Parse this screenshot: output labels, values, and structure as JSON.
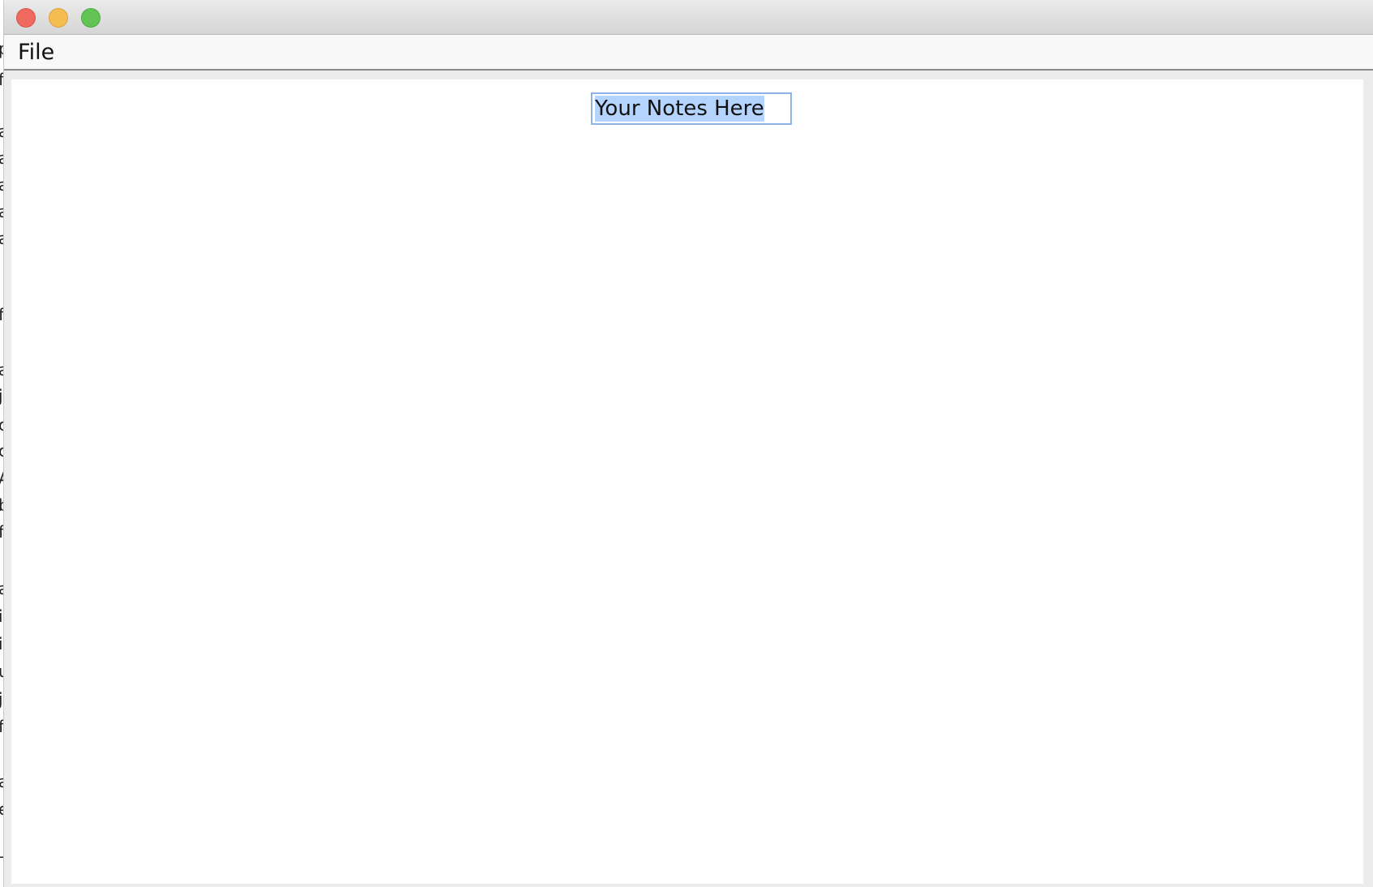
{
  "window": {
    "controls": {
      "close_icon": "close-icon",
      "minimize_icon": "minimize-icon",
      "zoom_icon": "zoom-icon"
    }
  },
  "menubar": {
    "items": [
      {
        "label": "File"
      }
    ]
  },
  "notes_field": {
    "value": "Your Notes Here",
    "selected": true
  },
  "background_window_fragments": [
    "p",
    "f",
    "a",
    "a",
    "a",
    "a",
    "a",
    "f",
    "a",
    "j",
    "c",
    "c",
    "A",
    "b",
    "f",
    "a",
    "i",
    "i",
    "u",
    "j",
    "f",
    "a",
    "e",
    "—"
  ],
  "colors": {
    "close": "#ee6a5f",
    "minimize": "#f5bd4f",
    "zoom": "#61c454",
    "selection": "#b4d4fd",
    "focus_border": "#8db3e6"
  }
}
